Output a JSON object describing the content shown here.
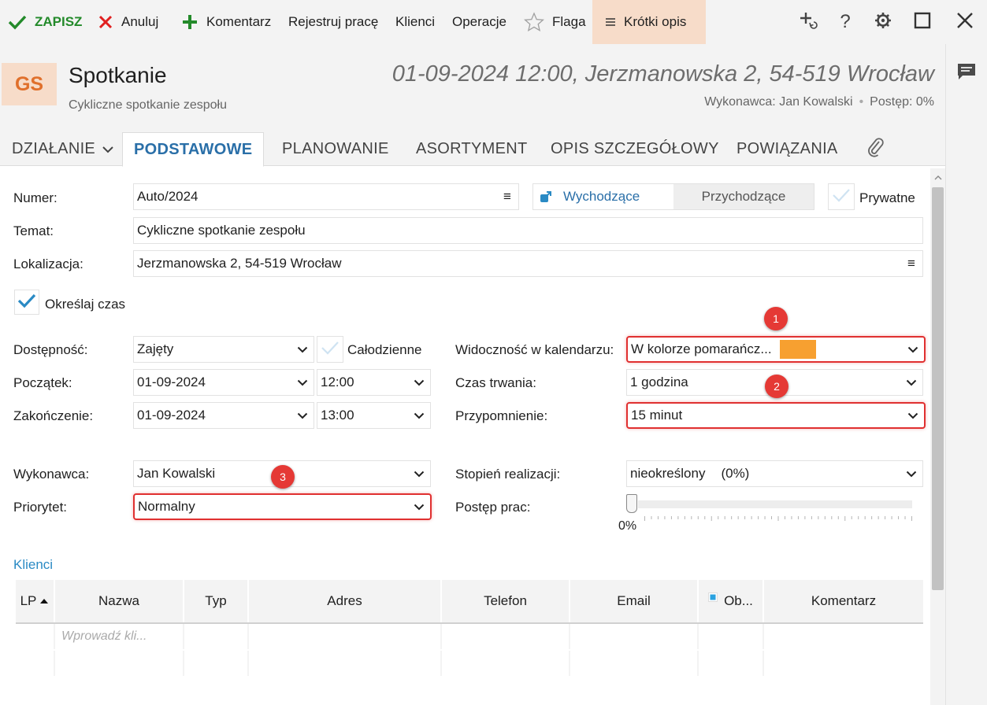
{
  "toolbar": {
    "save": "ZAPISZ",
    "cancel": "Anuluj",
    "comment": "Komentarz",
    "register": "Rejestruj pracę",
    "clients": "Klienci",
    "operations": "Operacje",
    "flag": "Flaga",
    "short_desc": "Krótki opis"
  },
  "header": {
    "badge": "GS",
    "title": "Spotkanie",
    "subtitle": "Cykliczne spotkanie zespołu",
    "when": "01-09-2024 12:00, Jerzmanowska 2, 54-519 Wrocław",
    "executor": "Wykonawca: Jan Kowalski",
    "progress": "Postęp: 0%"
  },
  "tabs": [
    "DZIAŁANIE",
    "PODSTAWOWE",
    "PLANOWANIE",
    "ASORTYMENT",
    "OPIS SZCZEGÓŁOWY",
    "POWIĄZANIA"
  ],
  "form": {
    "number_label": "Numer:",
    "number_value": "Auto/2024",
    "direction_out": "Wychodzące",
    "direction_in": "Przychodzące",
    "private_label": "Prywatne",
    "topic_label": "Temat:",
    "topic_value": "Cykliczne spotkanie zespołu",
    "location_label": "Lokalizacja:",
    "location_value": "Jerzmanowska 2, 54-519 Wrocław",
    "specify_time_label": "Określaj czas",
    "availability_label": "Dostępność:",
    "availability_value": "Zajęty",
    "allday_label": "Całodzienne",
    "start_label": "Początek:",
    "start_date": "01-09-2024",
    "start_time": "12:00",
    "end_label": "Zakończenie:",
    "end_date": "01-09-2024",
    "end_time": "13:00",
    "visibility_label": "Widoczność w kalendarzu:",
    "visibility_value": "W kolorze pomarańcz...",
    "duration_label": "Czas trwania:",
    "duration_value": "1 godzina",
    "reminder_label": "Przypomnienie:",
    "reminder_value": "15 minut",
    "executor_label": "Wykonawca:",
    "executor_value": "Jan Kowalski",
    "priority_label": "Priorytet:",
    "priority_value": "Normalny",
    "completion_label": "Stopień realizacji:",
    "completion_value": "nieokreślony",
    "completion_percent": "(0%)",
    "work_progress_label": "Postęp prac:",
    "work_progress_value": "0%",
    "work_progress_fraction": 0
  },
  "markers": [
    "1",
    "2",
    "3"
  ],
  "clients": {
    "title": "Klienci",
    "columns": [
      "LP",
      "Nazwa",
      "Typ",
      "Adres",
      "Telefon",
      "Email",
      "Ob...",
      "Komentarz"
    ],
    "new_row_placeholder": "Wprowadź kli..."
  },
  "colors": {
    "accent": "#2a6fa8",
    "save_green": "#238a2a",
    "highlight_red": "#e03030",
    "badge_bg": "#f7dcc9",
    "orange_swatch": "#f7a030"
  }
}
